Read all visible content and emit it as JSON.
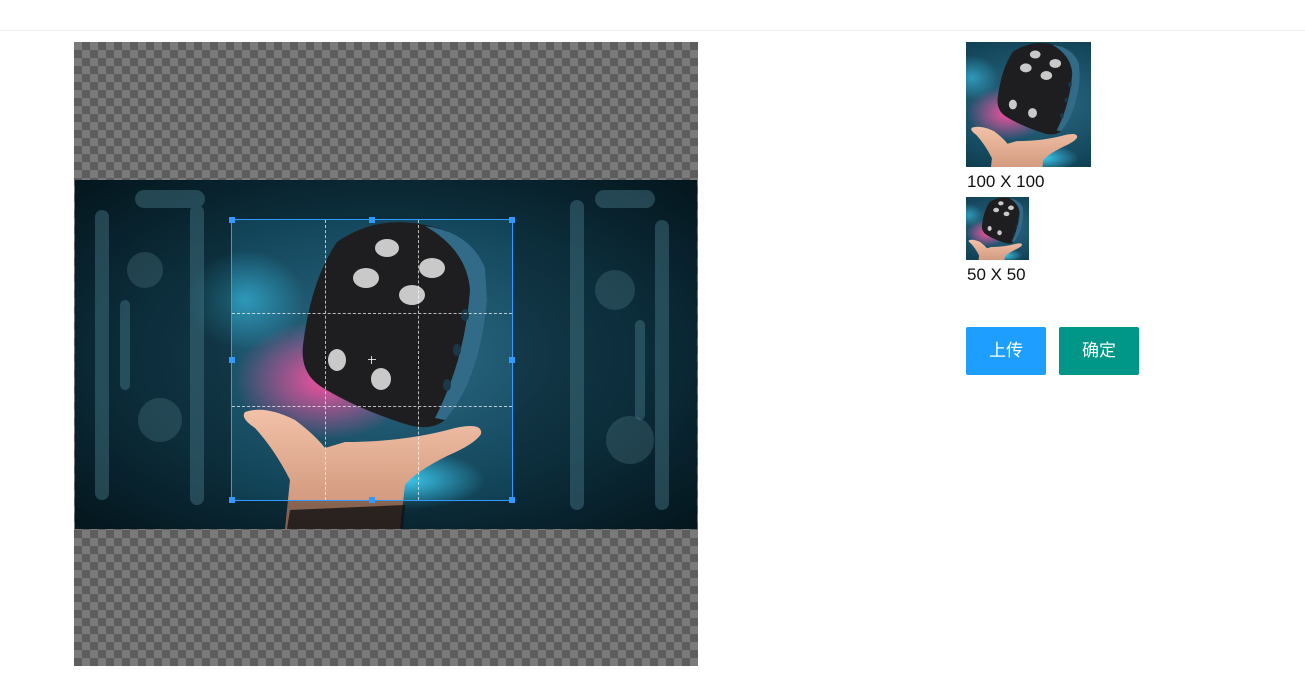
{
  "preview": {
    "large_label": "100 X 100",
    "small_label": "50 X 50"
  },
  "actions": {
    "upload_label": "上传",
    "confirm_label": "确定"
  },
  "colors": {
    "upload": "#1e9fff",
    "confirm": "#009688",
    "crop_outline": "#3399ff"
  },
  "image": {
    "subject": "die-on-hand-photo"
  }
}
